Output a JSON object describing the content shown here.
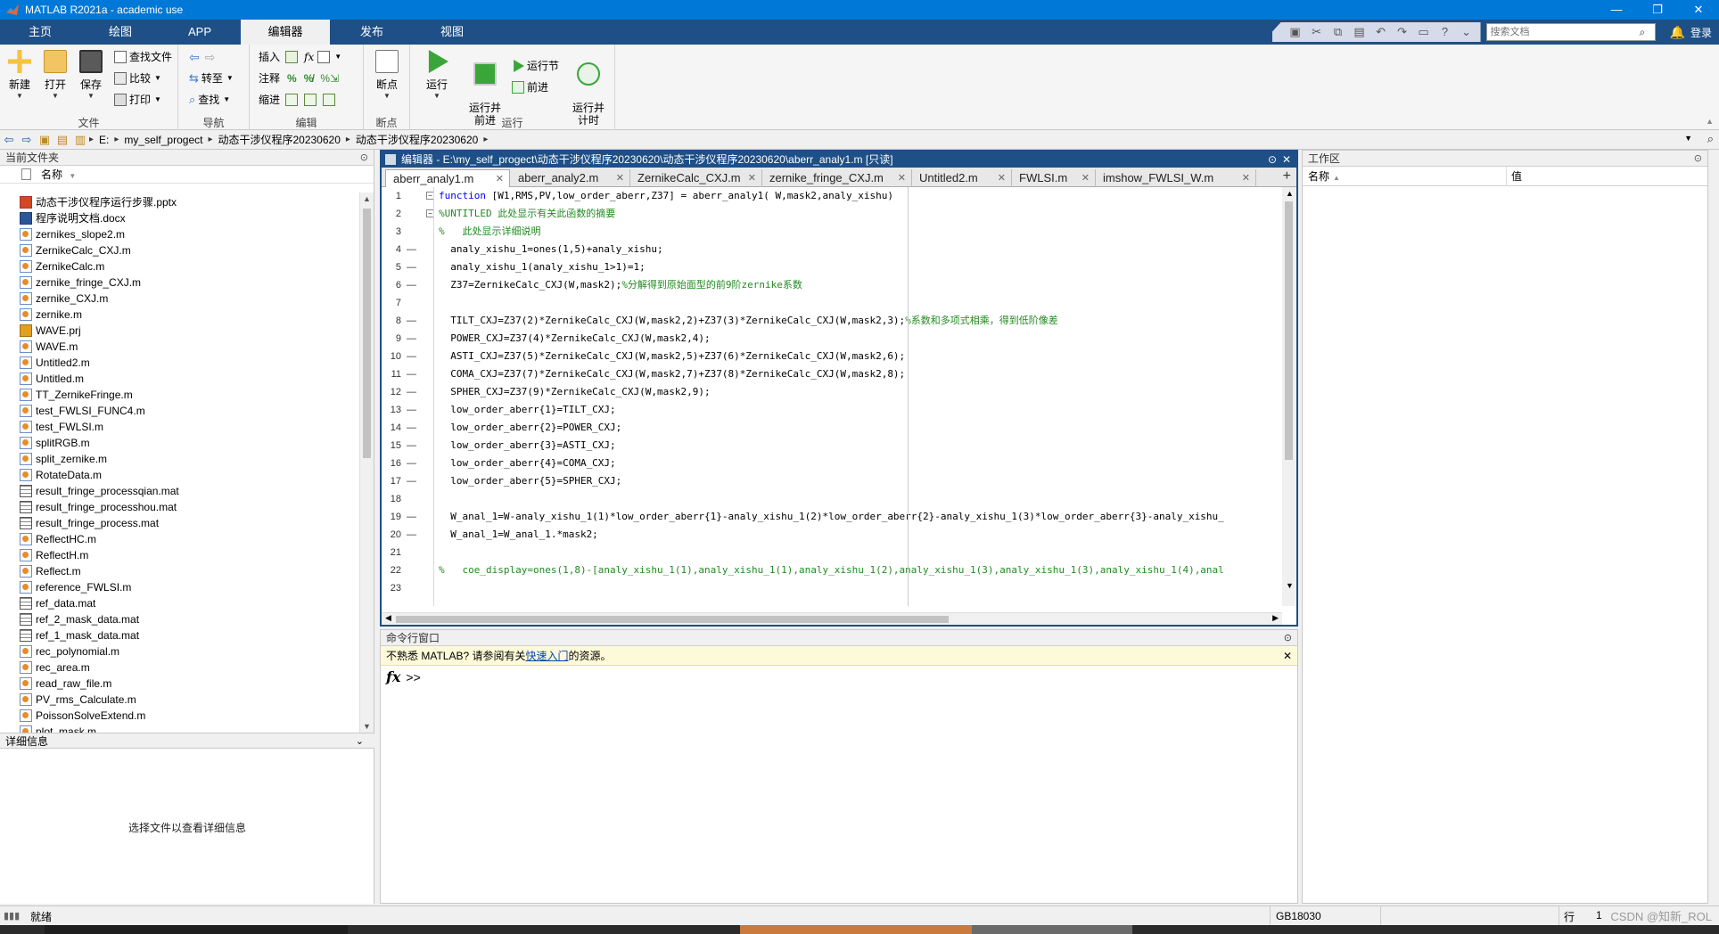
{
  "window": {
    "title": "MATLAB R2021a - academic use",
    "controls": [
      "—",
      "❐",
      "✕"
    ]
  },
  "tabs": [
    "主页",
    "绘图",
    "APP",
    "编辑器",
    "发布",
    "视图"
  ],
  "search": {
    "placeholder": "搜索文档"
  },
  "login": "登录",
  "ribbon": {
    "file": {
      "new": "新建",
      "open": "打开",
      "save": "保存",
      "find_files": "查找文件",
      "compare": "比较",
      "print": "打印",
      "label": "文件"
    },
    "navigate": {
      "goto": "转至",
      "find": "查找",
      "label": "导航"
    },
    "edit": {
      "insert": "插入",
      "comment": "注释",
      "indent": "缩进",
      "label": "编辑"
    },
    "breakpoints": {
      "breakpoint": "断点",
      "label": "断点"
    },
    "run": {
      "run": "运行",
      "run_advance": "运行并\n前进",
      "run_section": "运行节",
      "advance": "前进",
      "run_time": "运行并\n计时",
      "label": "运行"
    }
  },
  "address": {
    "drive": "E:",
    "path": [
      "my_self_progect",
      "动态干涉仪程序20230620",
      "动态干涉仪程序20230620"
    ]
  },
  "current_folder": {
    "title": "当前文件夹",
    "column": "名称",
    "files": [
      {
        "name": "动态干涉仪程序运行步骤.pptx",
        "type": "pptx"
      },
      {
        "name": "程序说明文档.docx",
        "type": "docx"
      },
      {
        "name": "zernikes_slope2.m",
        "type": "m"
      },
      {
        "name": "ZernikeCalc_CXJ.m",
        "type": "m"
      },
      {
        "name": "ZernikeCalc.m",
        "type": "m"
      },
      {
        "name": "zernike_fringe_CXJ.m",
        "type": "m"
      },
      {
        "name": "zernike_CXJ.m",
        "type": "m"
      },
      {
        "name": "zernike.m",
        "type": "m"
      },
      {
        "name": "WAVE.prj",
        "type": "prj"
      },
      {
        "name": "WAVE.m",
        "type": "m"
      },
      {
        "name": "Untitled2.m",
        "type": "m"
      },
      {
        "name": "Untitled.m",
        "type": "m"
      },
      {
        "name": "TT_ZernikeFringe.m",
        "type": "m"
      },
      {
        "name": "test_FWLSI_FUNC4.m",
        "type": "m"
      },
      {
        "name": "test_FWLSI.m",
        "type": "m"
      },
      {
        "name": "splitRGB.m",
        "type": "m"
      },
      {
        "name": "split_zernike.m",
        "type": "m"
      },
      {
        "name": "RotateData.m",
        "type": "m"
      },
      {
        "name": "result_fringe_processqian.mat",
        "type": "mat"
      },
      {
        "name": "result_fringe_processhou.mat",
        "type": "mat"
      },
      {
        "name": "result_fringe_process.mat",
        "type": "mat"
      },
      {
        "name": "ReflectHC.m",
        "type": "m"
      },
      {
        "name": "ReflectH.m",
        "type": "m"
      },
      {
        "name": "Reflect.m",
        "type": "m"
      },
      {
        "name": "reference_FWLSI.m",
        "type": "m"
      },
      {
        "name": "ref_data.mat",
        "type": "mat"
      },
      {
        "name": "ref_2_mask_data.mat",
        "type": "mat"
      },
      {
        "name": "ref_1_mask_data.mat",
        "type": "mat"
      },
      {
        "name": "rec_polynomial.m",
        "type": "m"
      },
      {
        "name": "rec_area.m",
        "type": "m"
      },
      {
        "name": "read_raw_file.m",
        "type": "m"
      },
      {
        "name": "PV_rms_Calculate.m",
        "type": "m"
      },
      {
        "name": "PoissonSolveExtend.m",
        "type": "m"
      },
      {
        "name": "plot_mask.m",
        "type": "m"
      }
    ],
    "details_title": "详细信息",
    "details_text": "选择文件以查看详细信息"
  },
  "editor": {
    "title": "编辑器 - E:\\my_self_progect\\动态干涉仪程序20230620\\动态干涉仪程序20230620\\aberr_analy1.m [只读]",
    "tabs": [
      "aberr_analy1.m",
      "aberr_analy2.m",
      "ZernikeCalc_CXJ.m",
      "zernike_fringe_CXJ.m",
      "Untitled2.m",
      "FWLSI.m",
      "imshow_FWLSI_W.m"
    ],
    "plus": "+",
    "lines": [
      {
        "n": "1",
        "d": "",
        "code": "function [W1,RMS,PV,low_order_aberr,Z37] = aberr_analy1( W,mask2,analy_xishu)",
        "kind": "kw"
      },
      {
        "n": "2",
        "d": "",
        "code": "%UNTITLED 此处显示有关此函数的摘要",
        "kind": "cm"
      },
      {
        "n": "3",
        "d": "",
        "code": "%   此处显示详细说明",
        "kind": "cm"
      },
      {
        "n": "4",
        "d": "—",
        "code": "  analy_xishu_1=ones(1,5)+analy_xishu;",
        "kind": ""
      },
      {
        "n": "5",
        "d": "—",
        "code": "  analy_xishu_1(analy_xishu_1>1)=1;",
        "kind": ""
      },
      {
        "n": "6",
        "d": "—",
        "code": "  Z37=ZernikeCalc_CXJ(W,mask2);%分解得到原始面型的前9阶zernike系数",
        "kind": "mix"
      },
      {
        "n": "7",
        "d": "",
        "code": "",
        "kind": ""
      },
      {
        "n": "8",
        "d": "—",
        "code": "  TILT_CXJ=Z37(2)*ZernikeCalc_CXJ(W,mask2,2)+Z37(3)*ZernikeCalc_CXJ(W,mask2,3);%系数和多项式相乘，得到低阶像差",
        "kind": "mix"
      },
      {
        "n": "9",
        "d": "—",
        "code": "  POWER_CXJ=Z37(4)*ZernikeCalc_CXJ(W,mask2,4);",
        "kind": ""
      },
      {
        "n": "10",
        "d": "—",
        "code": "  ASTI_CXJ=Z37(5)*ZernikeCalc_CXJ(W,mask2,5)+Z37(6)*ZernikeCalc_CXJ(W,mask2,6);",
        "kind": ""
      },
      {
        "n": "11",
        "d": "—",
        "code": "  COMA_CXJ=Z37(7)*ZernikeCalc_CXJ(W,mask2,7)+Z37(8)*ZernikeCalc_CXJ(W,mask2,8);",
        "kind": ""
      },
      {
        "n": "12",
        "d": "—",
        "code": "  SPHER_CXJ=Z37(9)*ZernikeCalc_CXJ(W,mask2,9);",
        "kind": ""
      },
      {
        "n": "13",
        "d": "—",
        "code": "  low_order_aberr{1}=TILT_CXJ;",
        "kind": ""
      },
      {
        "n": "14",
        "d": "—",
        "code": "  low_order_aberr{2}=POWER_CXJ;",
        "kind": ""
      },
      {
        "n": "15",
        "d": "—",
        "code": "  low_order_aberr{3}=ASTI_CXJ;",
        "kind": ""
      },
      {
        "n": "16",
        "d": "—",
        "code": "  low_order_aberr{4}=COMA_CXJ;",
        "kind": ""
      },
      {
        "n": "17",
        "d": "—",
        "code": "  low_order_aberr{5}=SPHER_CXJ;",
        "kind": ""
      },
      {
        "n": "18",
        "d": "",
        "code": "",
        "kind": ""
      },
      {
        "n": "19",
        "d": "—",
        "code": "  W_anal_1=W-analy_xishu_1(1)*low_order_aberr{1}-analy_xishu_1(2)*low_order_aberr{2}-analy_xishu_1(3)*low_order_aberr{3}-analy_xishu_",
        "kind": ""
      },
      {
        "n": "20",
        "d": "—",
        "code": "  W_anal_1=W_anal_1.*mask2;",
        "kind": ""
      },
      {
        "n": "21",
        "d": "",
        "code": "",
        "kind": ""
      },
      {
        "n": "22",
        "d": "",
        "code": "%   coe_display=ones(1,8)-[analy_xishu_1(1),analy_xishu_1(1),analy_xishu_1(2),analy_xishu_1(3),analy_xishu_1(3),analy_xishu_1(4),anal",
        "kind": "cm"
      },
      {
        "n": "23",
        "d": "",
        "code": "",
        "kind": ""
      }
    ]
  },
  "command_window": {
    "title": "命令行窗口",
    "banner_prefix": "不熟悉 MATLAB? 请参阅有关",
    "banner_link": "快速入门",
    "banner_suffix": "的资源。",
    "prompt": ">>"
  },
  "workspace": {
    "title": "工作区",
    "col_name": "名称",
    "col_value": "值"
  },
  "statusbar": {
    "status": "就绪",
    "encoding": "GB18030",
    "row_label": "行",
    "row_value": "1",
    "watermark": "CSDN @知新_ROL"
  }
}
